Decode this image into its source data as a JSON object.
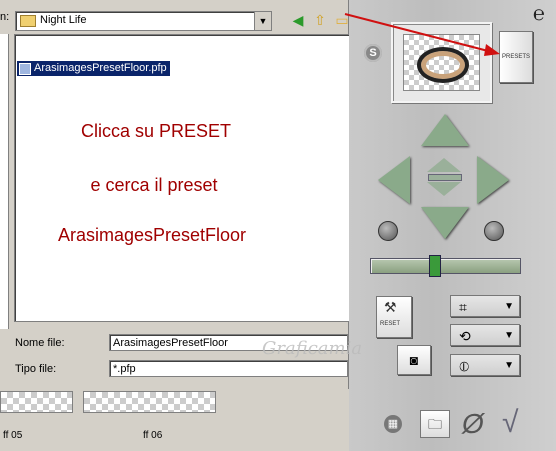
{
  "dialog": {
    "lookin_label": "n:",
    "lookin_value": "Night Life",
    "file_item": "ArasimagesPresetFloor.pfp",
    "name_label": "Nome file:",
    "name_value": "ArasimagesPresetFloor",
    "type_label": "Tipo file:",
    "type_value": "*.pfp"
  },
  "instructions": {
    "line1": "Clicca su PRESET",
    "line2": "e cerca il preset",
    "line3": "ArasimagesPresetFloor"
  },
  "thumbs": {
    "label1": "ff 05",
    "label2": "ff 06"
  },
  "panel": {
    "s_badge": "S",
    "preset_label": "PRESETS",
    "reset_label": "RESET",
    "grid_symbol": "⌗",
    "rotate_symbol": "⟲",
    "tilt_symbol": "⦶",
    "caret": "▼",
    "slider_value_fraction": 0.43,
    "slider_text": "≡ ≡ ≡ ≡"
  },
  "watermark": "Graficamia",
  "colors": {
    "instruction_red": "#a00000",
    "selection_blue": "#0a246a",
    "annotation_red": "#d01010"
  }
}
